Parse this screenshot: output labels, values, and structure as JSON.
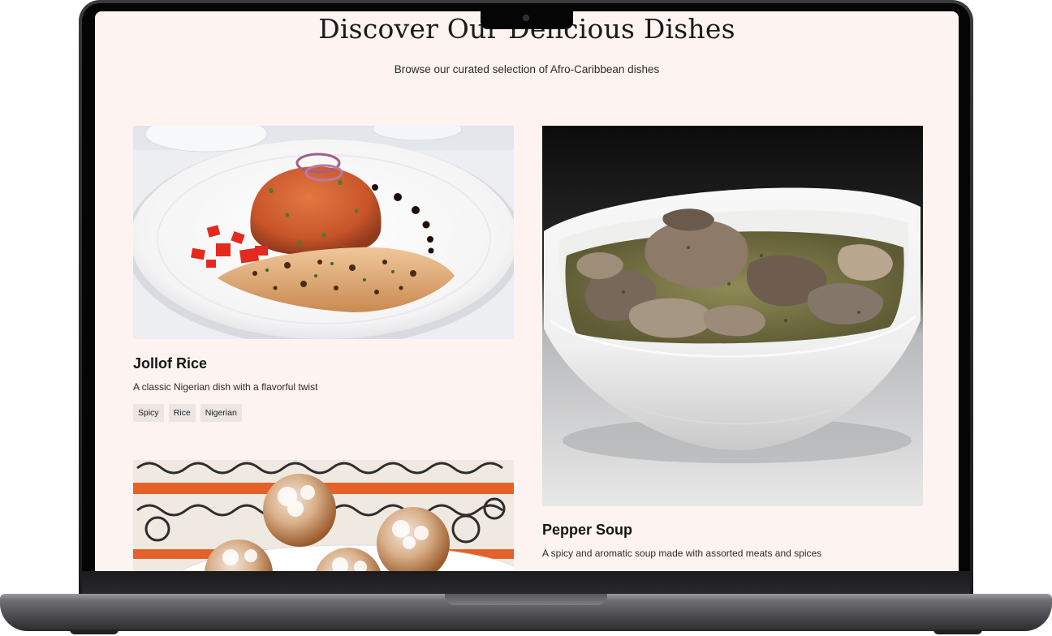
{
  "page": {
    "title": "Discover Our Delicious Dishes",
    "subtitle": "Browse our curated selection of Afro-Caribbean dishes"
  },
  "dishes": [
    {
      "name": "Jollof Rice",
      "description": "A classic Nigerian dish with a flavorful twist",
      "tags": [
        "Spicy",
        "Rice",
        "Nigerian"
      ],
      "image": "jollof-rice-photo"
    },
    {
      "name": "Pepper Soup",
      "description": "A spicy and aromatic soup made with assorted meats and spices",
      "image": "pepper-soup-photo"
    },
    {
      "image": "puff-puff-photo"
    }
  ],
  "colors": {
    "background": "#fdf3f0",
    "tag_bg": "#ebe5e3",
    "text": "#151515"
  }
}
